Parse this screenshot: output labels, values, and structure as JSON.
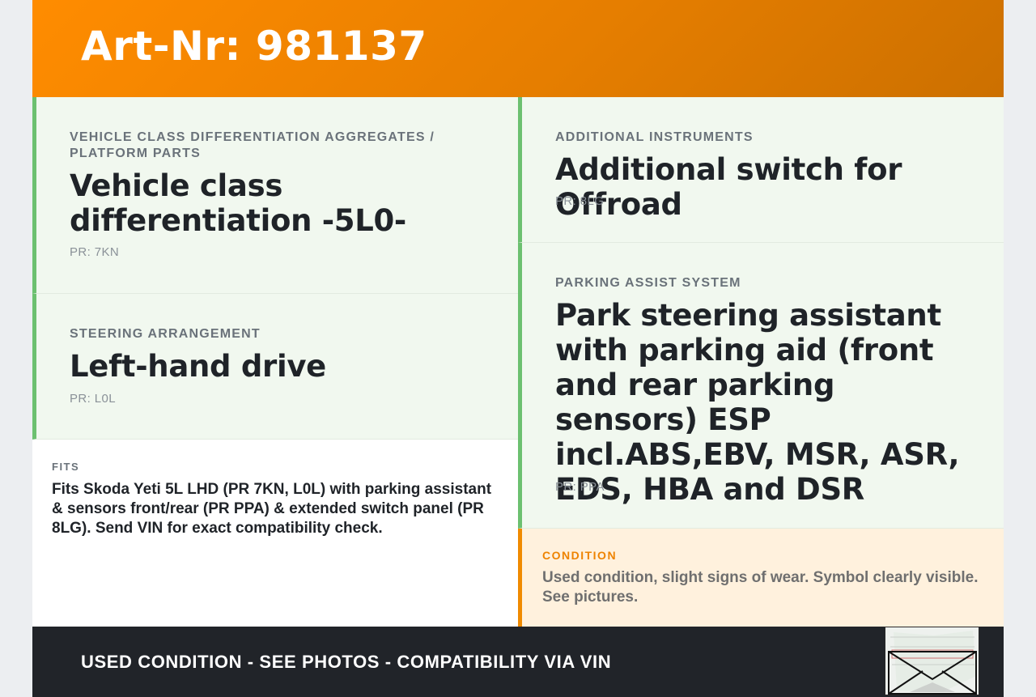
{
  "header": {
    "title": "Art-Nr: 981137"
  },
  "cards": {
    "vehicle_class": {
      "category": "VEHICLE CLASS DIFFERENTIATION AGGREGATES / PLATFORM PARTS",
      "value": "Vehicle class differentiation -5L0-",
      "pr": "PR: 7KN"
    },
    "steering": {
      "category": "STEERING ARRANGEMENT",
      "value": "Left-hand drive",
      "pr": "PR: L0L"
    },
    "instruments": {
      "category": "ADDITIONAL INSTRUMENTS",
      "value": "Additional switch for Offroad",
      "pr": "PR: 8LG"
    },
    "parking": {
      "category": "PARKING ASSIST SYSTEM",
      "value": "Park steering assistant with parking aid (front and rear parking sensors) ESP incl.ABS,EBV, MSR, ASR, EDS, HBA and DSR",
      "pr": "PR: PPA"
    }
  },
  "fits": {
    "label": "FITS",
    "text": "Fits Skoda Yeti 5L LHD (PR 7KN, L0L) with parking assistant & sensors front/rear (PR PPA) & extended switch panel (PR 8LG). Send VIN for exact compatibility check."
  },
  "condition": {
    "label": "CONDITION",
    "text": "Used condition, slight signs of wear. Symbol clearly visible. See pictures."
  },
  "footer": {
    "slogan": "USED CONDITION - SEE PHOTOS - COMPATIBILITY VIA VIN"
  },
  "colors": {
    "header_orange": "#ff8c00",
    "card_green_border": "#6cc070",
    "card_bg": "#f1f8ef",
    "condition_accent": "#f08a00",
    "condition_bg": "#fff1dd",
    "footer_bg": "#212429"
  }
}
